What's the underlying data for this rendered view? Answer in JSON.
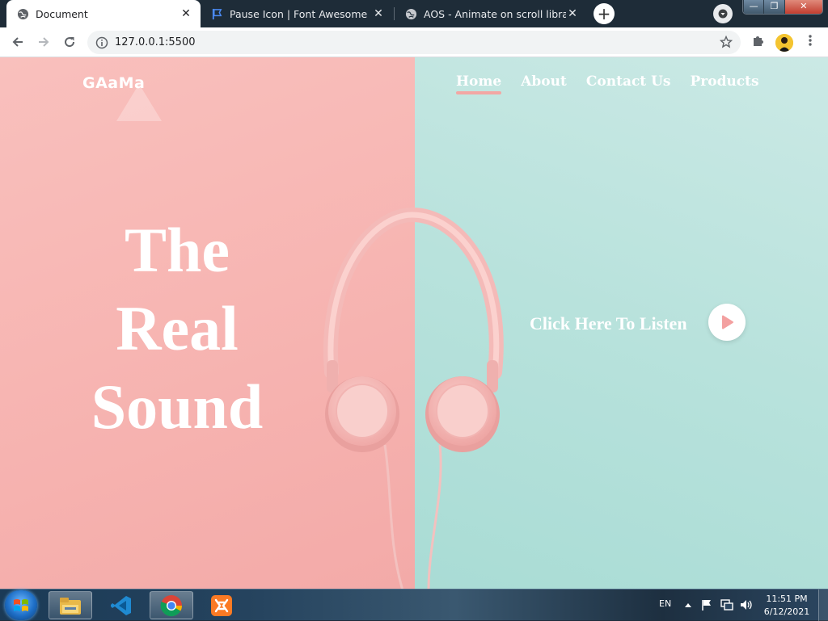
{
  "browser": {
    "tabs": [
      {
        "title": "Document",
        "active": true,
        "favicon": "globe-icon"
      },
      {
        "title": "Pause Icon | Font Awesome",
        "active": false,
        "favicon": "flag-icon"
      },
      {
        "title": "AOS - Animate on scroll library",
        "active": false,
        "favicon": "globe-icon"
      }
    ],
    "new_tab_label": "+",
    "address": "127.0.0.1:5500",
    "window_controls": {
      "minimize": "—",
      "maximize": "❐",
      "close": "✕"
    }
  },
  "site": {
    "logo": "GAaMa",
    "nav": [
      {
        "label": "Home",
        "active": true
      },
      {
        "label": "About",
        "active": false
      },
      {
        "label": "Contact Us",
        "active": false
      },
      {
        "label": "Products",
        "active": false
      }
    ],
    "hero_lines": [
      "The",
      "Real",
      "Sound"
    ],
    "cta_label": "Click Here To Listen",
    "colors": {
      "left_bg": "#f7b5b2",
      "right_bg": "#b8e2dc",
      "accent": "#f3a7a4"
    }
  },
  "taskbar": {
    "apps": [
      "file-explorer-icon",
      "vscode-icon",
      "chrome-icon",
      "xampp-icon"
    ],
    "language": "EN",
    "time": "11:51 PM",
    "date": "6/12/2021"
  }
}
